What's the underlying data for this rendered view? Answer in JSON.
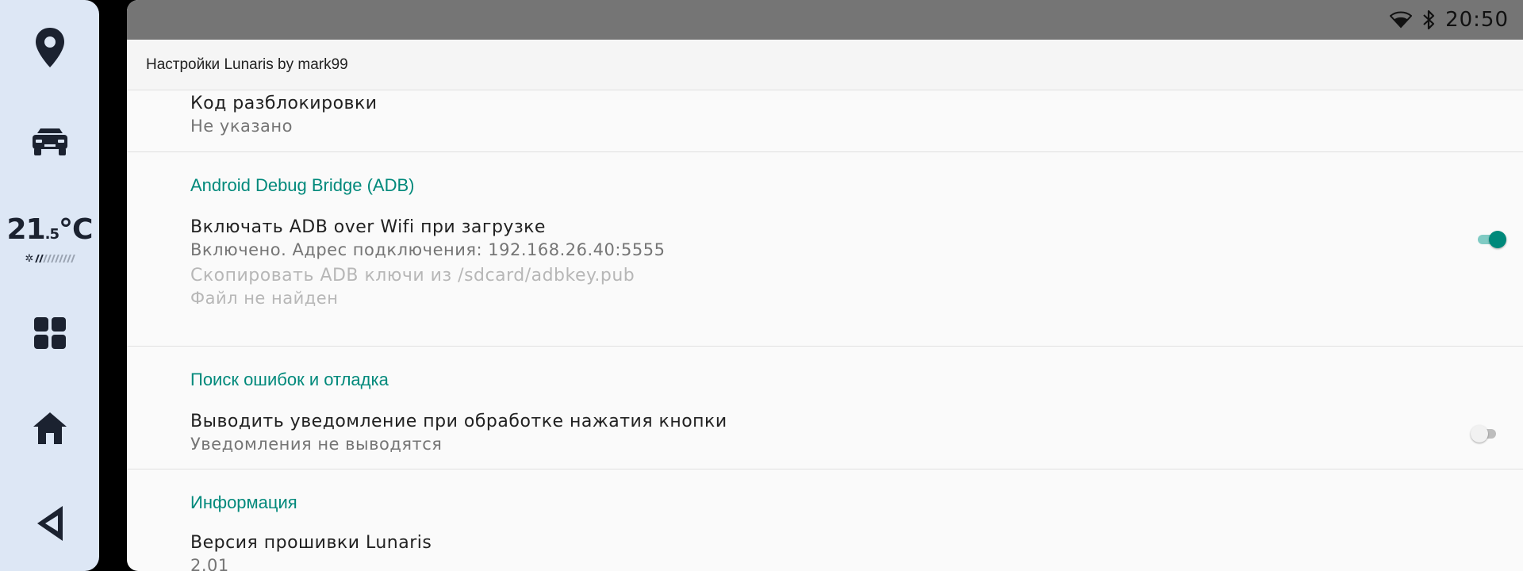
{
  "dock": {
    "climate": {
      "temp_int": "21",
      "temp_dec": ".5",
      "unit": "°C",
      "fan_level_fraction": 0.2
    },
    "icons": [
      "location-pin-icon",
      "car-icon",
      "apps-grid-icon",
      "home-icon",
      "back-icon"
    ]
  },
  "statusbar": {
    "time": "20:50",
    "icons": [
      "wifi-icon",
      "bluetooth-icon"
    ]
  },
  "appbar": {
    "title": "Настройки Lunaris by mark99"
  },
  "settings": {
    "unlock_code": {
      "title": "Код разблокировки",
      "summary": "Не указано"
    },
    "adb_category": "Android Debug Bridge (ADB)",
    "adb_wifi": {
      "title": "Включать ADB over Wifi при загрузке",
      "summary": "Включено. Адрес подключения: 192.168.26.40:5555",
      "enabled": true
    },
    "adb_keys": {
      "title": "Скопировать ADB ключи из /sdcard/adbkey.pub",
      "summary": "Файл не найден"
    },
    "debug_category": "Поиск ошибок и отладка",
    "button_notify": {
      "title": "Выводить уведомление при обработке нажатия кнопки",
      "summary": "Уведомления не выводятся",
      "enabled": false
    },
    "info_category": "Информация",
    "firmware": {
      "title": "Версия прошивки Lunaris",
      "summary": "2.01"
    }
  },
  "colors": {
    "accent": "#00897b",
    "statusbar": "#757575",
    "dock": "#dde7f5"
  }
}
